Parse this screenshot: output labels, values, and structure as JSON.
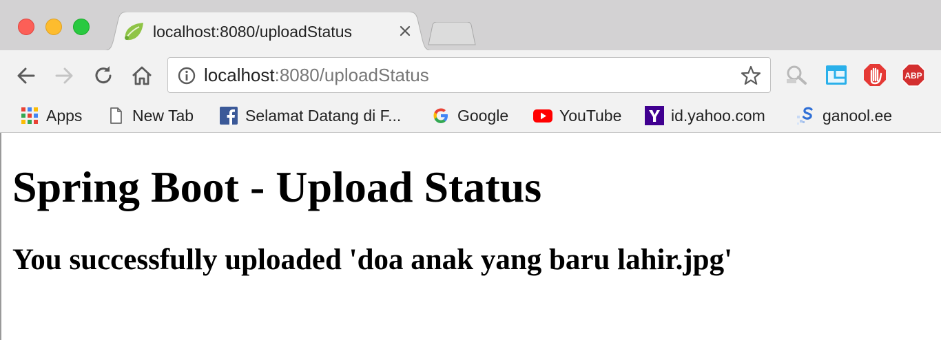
{
  "tab": {
    "title": "localhost:8080/uploadStatus",
    "favicon": "spring-leaf-icon"
  },
  "address_bar": {
    "host": "localhost",
    "rest": ":8080/uploadStatus"
  },
  "bookmarks": [
    {
      "label": "Apps",
      "icon": "apps-grid-icon"
    },
    {
      "label": "New Tab",
      "icon": "page-icon"
    },
    {
      "label": "Selamat Datang di F...",
      "icon": "facebook-icon"
    },
    {
      "label": "Google",
      "icon": "google-icon"
    },
    {
      "label": "YouTube",
      "icon": "youtube-icon"
    },
    {
      "label": "id.yahoo.com",
      "icon": "yahoo-icon"
    },
    {
      "label": "ganool.ee",
      "icon": "ganool-icon"
    }
  ],
  "extensions": {
    "abp_label": "ABP"
  },
  "page": {
    "heading": "Spring Boot - Upload Status",
    "message": "You successfully uploaded 'doa anak yang baru lahir.jpg'"
  },
  "colors": {
    "close": "#fc5f57",
    "minimize": "#fdbc2e",
    "maximize": "#29c940",
    "chrome_bg": "#f2f2f2",
    "tabstrip_bg": "#d3d2d3"
  }
}
